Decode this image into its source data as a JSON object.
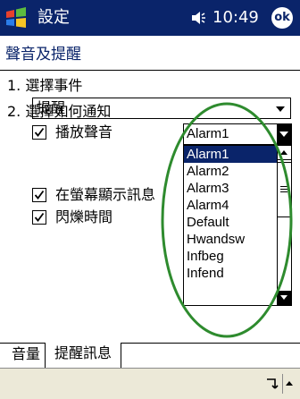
{
  "titlebar": {
    "title": "設定",
    "time": "10:49",
    "ok_label": "ok"
  },
  "page": {
    "heading": "聲音及提醒"
  },
  "step1": {
    "label": "1. 選擇事件",
    "selected_event": "提醒"
  },
  "step2": {
    "label": "2. 選擇如何通知",
    "options": [
      {
        "label": "播放聲音",
        "checked": true
      },
      {
        "label": "在螢幕顯示訊息",
        "checked": true
      },
      {
        "label": "閃爍時間",
        "checked": true
      }
    ]
  },
  "sound": {
    "selected": "Alarm1",
    "list": [
      "Alarm1",
      "Alarm2",
      "Alarm3",
      "Alarm4",
      "Default",
      "Hwandsw",
      "Infbeg",
      "Infend"
    ],
    "highlighted_index": 0
  },
  "tabs": [
    {
      "label": "音量",
      "active": false
    },
    {
      "label": "提醒訊息",
      "active": true
    }
  ],
  "colors": {
    "titlebar": "#0a246a",
    "selection": "#0a246a",
    "annotation": "#2e8b2e"
  },
  "icons": {
    "start": "windows-flag-icon",
    "volume": "speaker-icon",
    "sip": "keyboard-icon"
  }
}
